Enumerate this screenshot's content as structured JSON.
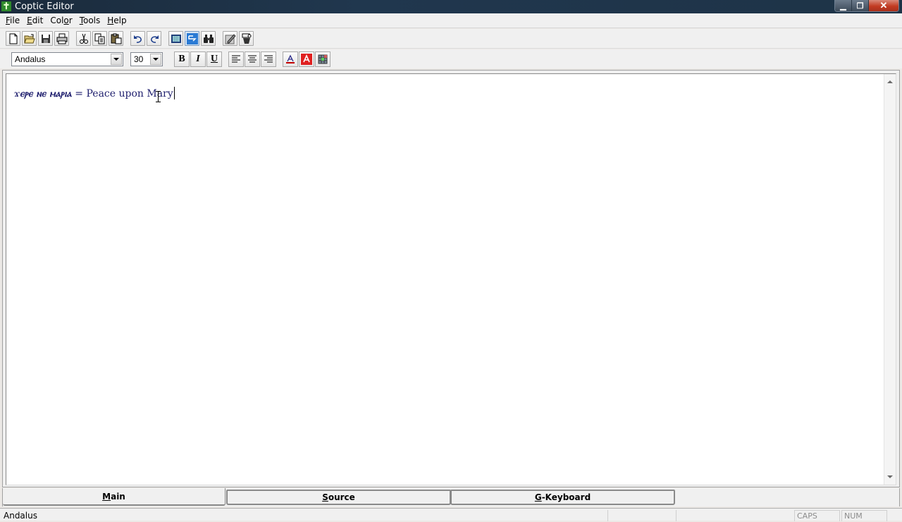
{
  "window": {
    "title": "Coptic Editor",
    "app_icon": "coptic-cross-icon",
    "controls": {
      "minimize": "minimize-icon",
      "maximize": "restore-icon",
      "close": "close-icon"
    }
  },
  "menu": [
    {
      "label": "File",
      "mnemonic": "F"
    },
    {
      "label": "Edit",
      "mnemonic": "E"
    },
    {
      "label": "Color",
      "mnemonic": "o"
    },
    {
      "label": "Tools",
      "mnemonic": "T"
    },
    {
      "label": "Help",
      "mnemonic": "H"
    }
  ],
  "toolbar": {
    "buttons": [
      {
        "name": "new",
        "icon": "new-document-icon"
      },
      {
        "name": "open",
        "icon": "open-folder-icon"
      },
      {
        "name": "save",
        "icon": "save-disk-icon"
      },
      {
        "name": "print",
        "icon": "printer-icon"
      },
      {
        "name": "cut",
        "icon": "scissors-icon"
      },
      {
        "name": "copy",
        "icon": "copy-icon"
      },
      {
        "name": "paste",
        "icon": "paste-icon"
      },
      {
        "name": "undo",
        "icon": "undo-icon"
      },
      {
        "name": "redo",
        "icon": "redo-icon"
      },
      {
        "name": "view",
        "icon": "window-icon"
      },
      {
        "name": "keyboard-mode",
        "icon": "keyboard-mode-icon",
        "active": true
      },
      {
        "name": "find",
        "icon": "binoculars-icon"
      },
      {
        "name": "edit-image",
        "icon": "pencil-edit-icon"
      },
      {
        "name": "tool",
        "icon": "wizard-icon"
      }
    ]
  },
  "format": {
    "font_name": "Andalus",
    "font_size": "30",
    "bold_label": "B",
    "italic_label": "I",
    "underline_label": "U",
    "text_color": "#c00000",
    "highlight_color": "#e02020"
  },
  "editor": {
    "coptic_text": "ϫⲉⲣⲉ ⲛⲉ ⲙⲁⲣⲓⲁ",
    "plain_text": " = Peace upon Mary",
    "text_color": "#1f1f6e"
  },
  "tabs": [
    {
      "label": "Main",
      "mnemonic": "M",
      "rest": "ain",
      "active": true
    },
    {
      "label": "Source",
      "mnemonic": "S",
      "rest": "ource",
      "active": false
    },
    {
      "label": "G-Keyboard",
      "mnemonic": "G",
      "rest": "-Keyboard",
      "active": false
    }
  ],
  "status": {
    "font": "Andalus",
    "caps": "CAPS",
    "num": "NUM"
  }
}
